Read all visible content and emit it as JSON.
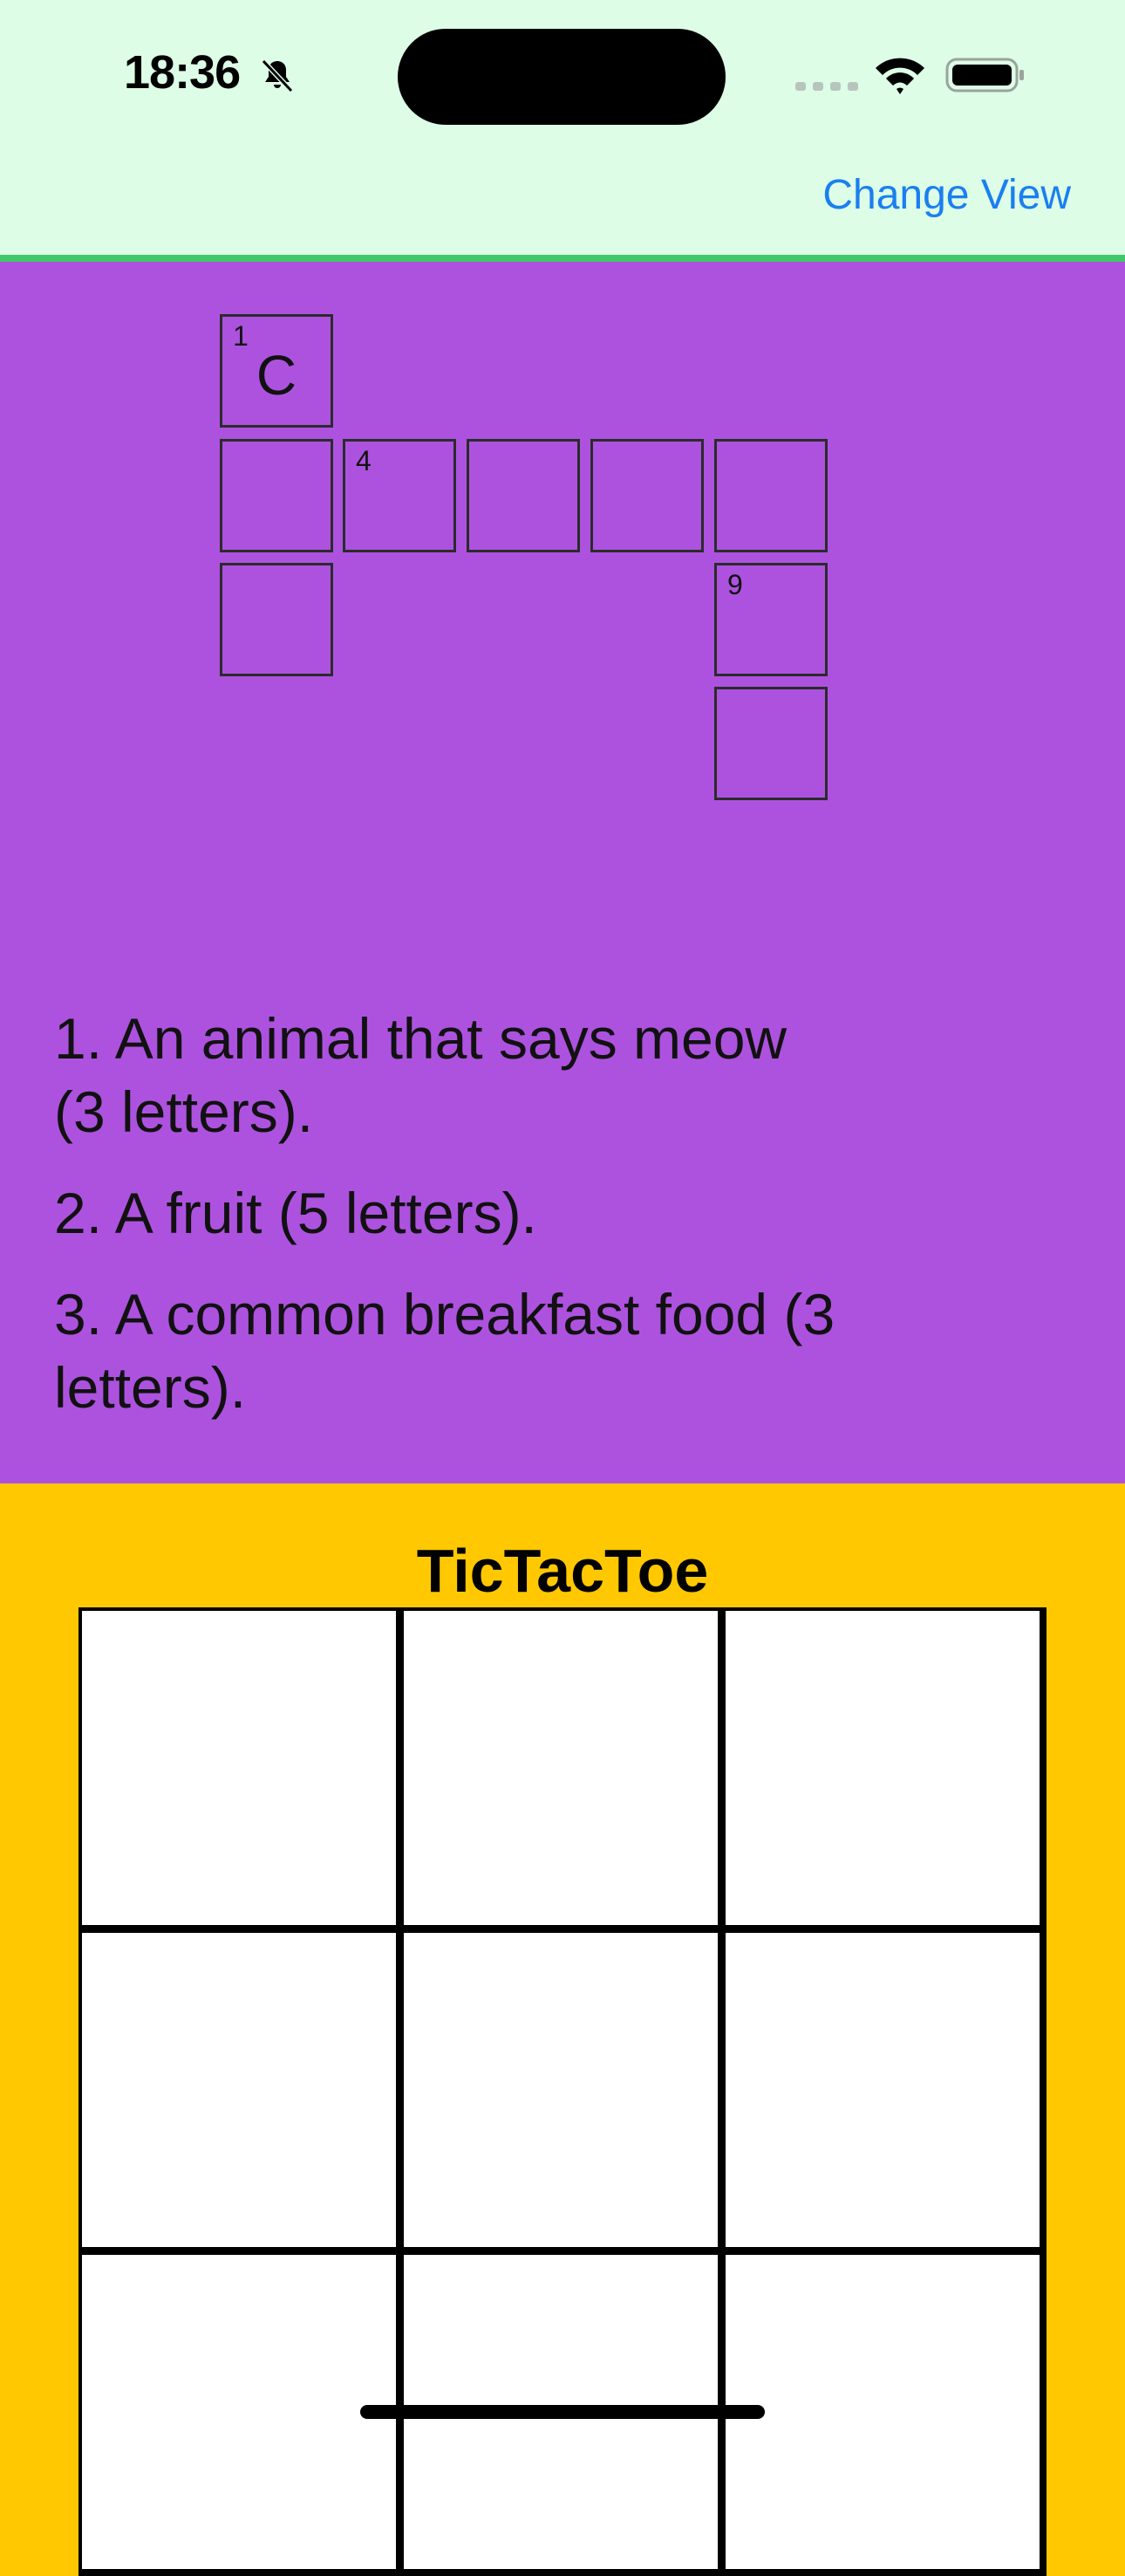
{
  "status_bar": {
    "time": "18:36",
    "icons": [
      "bell-slash-icon",
      "cellular-signal-icon",
      "wifi-icon",
      "battery-icon"
    ]
  },
  "nav": {
    "change_view_label": "Change View"
  },
  "colors": {
    "header_bg": "#DDFDE6",
    "header_border": "#3FC86A",
    "link": "#1A7FF0",
    "crossword_bg": "#AD52DF",
    "tictactoe_bg": "#FFC800"
  },
  "crossword": {
    "cells": [
      {
        "number": "1",
        "letter": "C"
      },
      {
        "number": "",
        "letter": ""
      },
      {
        "number": "4",
        "letter": ""
      },
      {
        "number": "",
        "letter": ""
      },
      {
        "number": "",
        "letter": ""
      },
      {
        "number": "",
        "letter": ""
      },
      {
        "number": "",
        "letter": ""
      },
      {
        "number": "9",
        "letter": ""
      },
      {
        "number": "",
        "letter": ""
      }
    ],
    "clues": [
      "1. An animal that says meow (3 letters).",
      "2. A fruit (5 letters).",
      "3. A common breakfast food (3 letters)."
    ]
  },
  "tictactoe": {
    "title": "TicTacToe",
    "cells": [
      "",
      "",
      "",
      "",
      "",
      "",
      "",
      "",
      ""
    ]
  }
}
